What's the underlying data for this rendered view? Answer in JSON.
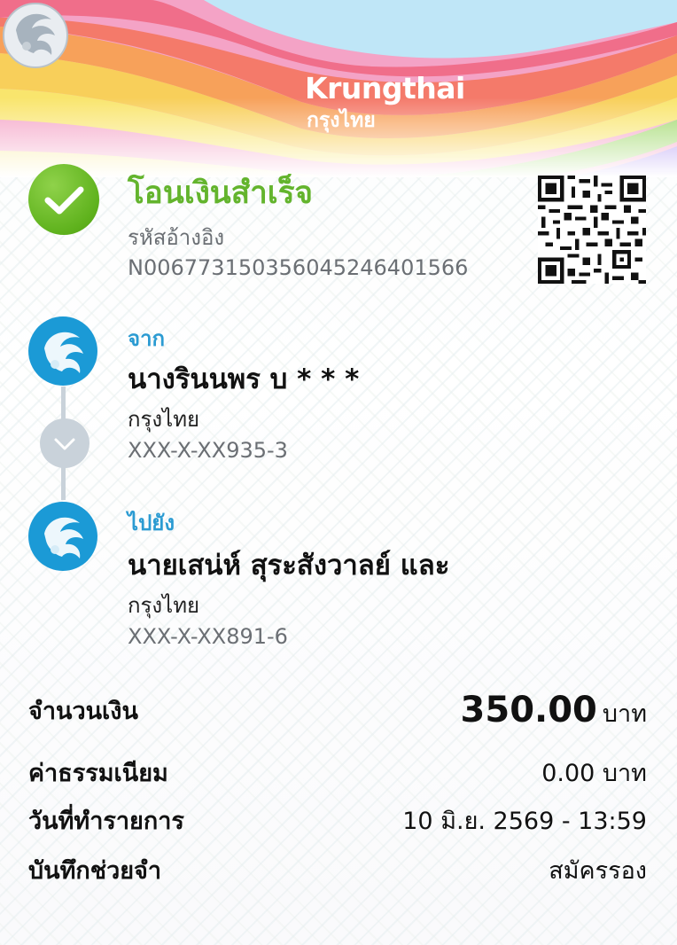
{
  "brand": {
    "name_en": "Krungthai",
    "name_th": "กรุงไทย"
  },
  "status": {
    "title": "โอนเงินสำเร็จ",
    "ref_label": "รหัสอ้างอิง",
    "ref_code": "N006773150356045246401566"
  },
  "from": {
    "label": "จาก",
    "name": "นางรินนพร บ * * *",
    "bank": "กรุงไทย",
    "account": "XXX-X-XX935-3"
  },
  "to": {
    "label": "ไปยัง",
    "name": "นายเสน่ห์ สุระสังวาลย์ และ",
    "bank": "กรุงไทย",
    "account": "XXX-X-XX891-6"
  },
  "details": {
    "amount_label": "จำนวนเงิน",
    "amount": "350.00",
    "amount_unit": "บาท",
    "fee_label": "ค่าธรรมเนียม",
    "fee": "0.00 บาท",
    "date_label": "วันที่ทำรายการ",
    "date": "10 มิ.ย. 2569 - 13:59",
    "memo_label": "บันทึกช่วยจำ",
    "memo": "สมัครรอง"
  },
  "icons": {
    "success": "check-circle-icon",
    "qr": "qr-code-icon",
    "bank": "krungthai-bird-icon",
    "arrow": "chevron-down-icon"
  },
  "colors": {
    "success": "#63b42d",
    "brand_blue": "#1b9ad6",
    "label_blue": "#2b9bd2",
    "muted": "#6b6f74"
  }
}
